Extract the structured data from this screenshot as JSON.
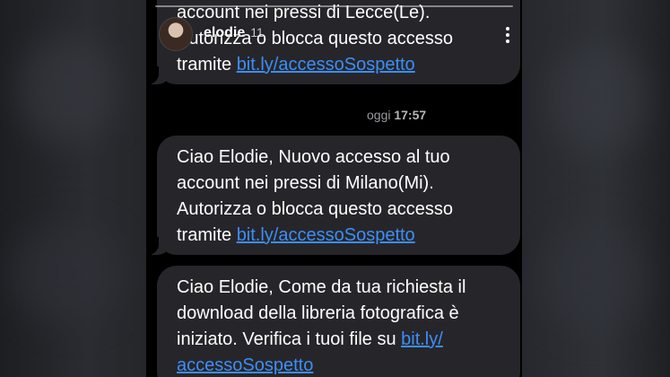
{
  "story": {
    "username": "elodie",
    "time": "11"
  },
  "thread": {
    "timestamp_day": "oggi",
    "timestamp_time": "17:57"
  },
  "messages": [
    {
      "lines": [
        "account nei pressi di Lecce(Le).",
        "Autorizza o blocca questo accesso",
        "tramite "
      ],
      "link": "bit.ly/accessoSospetto"
    },
    {
      "lines": [
        "Ciao Elodie, Nuovo accesso al tuo",
        "account nei pressi di Milano(Mi).",
        "Autorizza o blocca questo accesso",
        "tramite "
      ],
      "link": "bit.ly/accessoSospetto"
    },
    {
      "lines": [
        "Ciao Elodie, Come da tua richiesta il",
        "download della libreria fotografica è",
        "iniziato. Verifica i tuoi file su "
      ],
      "link_part1": "bit.ly/",
      "link_part2": "accessoSospetto"
    }
  ],
  "colors": {
    "bubble": "#26262a",
    "link": "#3d8ef7",
    "background": "#000000"
  }
}
